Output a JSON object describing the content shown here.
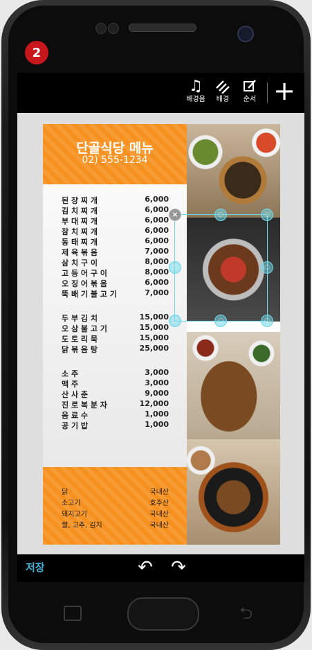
{
  "badge": "2",
  "toolbar": {
    "bgm": {
      "icon": "music-note-icon",
      "label": "배경음"
    },
    "background": {
      "icon": "pattern-stripes-icon",
      "label": "배경"
    },
    "order": {
      "icon": "edit-order-icon",
      "label": "순서"
    },
    "add": {
      "icon": "plus-icon",
      "label": "+"
    }
  },
  "menu_card": {
    "title": "단골식당 메뉴",
    "phone": "02) 555-1234",
    "items": [
      {
        "name": "된 장 찌 개",
        "price": "6,000"
      },
      {
        "name": "김 치 찌 개",
        "price": "6,000"
      },
      {
        "name": "부 대 찌 개",
        "price": "6,000"
      },
      {
        "name": "참 치 찌 개",
        "price": "6,000"
      },
      {
        "name": "동 태 찌 개",
        "price": "6,000"
      },
      {
        "name": "제 육 볶 음",
        "price": "7,000"
      },
      {
        "name": "삼 치 구 이",
        "price": "8,000"
      },
      {
        "name": "고 등 어 구 이",
        "price": "8,000"
      },
      {
        "name": "오 징 어 볶 음",
        "price": "6,000"
      },
      {
        "name": "뚝 배 기 불 고 기",
        "price": "7,000"
      },
      {
        "name": "두 부 김 치",
        "price": "15,000"
      },
      {
        "name": "오 삼 불 고 기",
        "price": "15,000"
      },
      {
        "name": "도 토 리 묵",
        "price": "15,000"
      },
      {
        "name": "닭 볶 음 탕",
        "price": "25,000"
      },
      {
        "name": "소 주",
        "price": "3,000"
      },
      {
        "name": "맥 주",
        "price": "3,000"
      },
      {
        "name": "산 사 춘",
        "price": "9,000"
      },
      {
        "name": "진 로 복 분 자",
        "price": "12,000"
      },
      {
        "name": "음 료 수",
        "price": "1,000"
      },
      {
        "name": "공 기 밥",
        "price": "1,000"
      }
    ],
    "origins": [
      {
        "name": "닭",
        "src": "국내산"
      },
      {
        "name": "소고기",
        "src": "호주산"
      },
      {
        "name": "돼지고기",
        "src": "국내산"
      },
      {
        "name": "쌀, 고추, 김치",
        "src": "국내산"
      }
    ]
  },
  "selection": {
    "close_icon": "close-icon",
    "handle_icon": "resize-handle-icon",
    "close_glyph": "×",
    "handle_glyph": "◌"
  },
  "bottombar": {
    "save_label": "저장",
    "undo_icon": "undo-icon",
    "redo_icon": "redo-icon"
  },
  "colors": {
    "accent_orange": "#f6901e",
    "save_blue": "#43b3d8",
    "selection_cyan": "#6fd7e8",
    "badge_red": "#c8161d"
  }
}
